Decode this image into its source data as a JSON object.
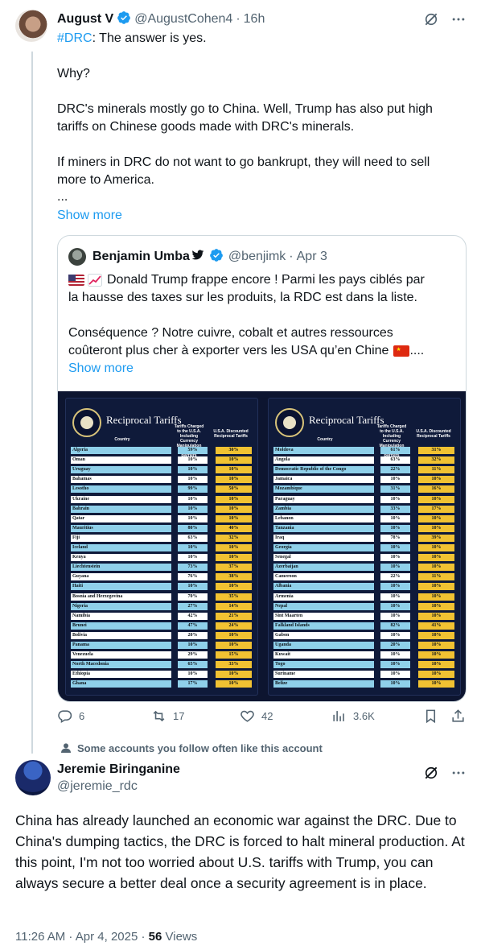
{
  "tweet": {
    "author_name": "August V",
    "author_handle": "@AugustCohen4",
    "time": "16h",
    "hashtag": "#DRC",
    "line1": ": The answer is yes.",
    "p2": "Why?",
    "p3a": "DRC's minerals mostly go to China.  Well, Trump has also put high",
    "p3b": "tariffs on Chinese goods made with DRC's minerals.",
    "p4a": "If miners in DRC do not want to go bankrupt, they will need to sell",
    "p4b": "more to America.",
    "ellipsis": "...",
    "show_more": "Show more",
    "stats": {
      "replies": "6",
      "reposts": "17",
      "likes": "42",
      "views": "3.6K"
    }
  },
  "quote": {
    "author_name": "Benjamin Umba",
    "author_handle": "@benjimk",
    "time": "Apr 3",
    "line1": "Donald Trump frappe encore ! Parmi les pays ciblés par",
    "line2": "la hausse des taxes sur les produits, la RDC est dans la liste.",
    "line3": "Conséquence ? Notre cuivre, cobalt et autres ressources",
    "line4": "coûteront plus cher à exporter vers les USA qu’en Chine",
    "line4_end": "....",
    "show_more": "Show more"
  },
  "tariff_image": {
    "title": "Reciprocal Tariffs",
    "col_country": "Country",
    "col_charged": "Tariffs Charged to the U.S.A. Including Currency Manipulation and Trade Barriers",
    "col_discounted": "U.S.A. Discounted Reciprocal Tariffs",
    "left": [
      [
        "Algeria",
        "59%",
        "30%"
      ],
      [
        "Oman",
        "10%",
        "10%"
      ],
      [
        "Uruguay",
        "10%",
        "10%"
      ],
      [
        "Bahamas",
        "10%",
        "10%"
      ],
      [
        "Lesotho",
        "99%",
        "50%"
      ],
      [
        "Ukraine",
        "10%",
        "10%"
      ],
      [
        "Bahrain",
        "10%",
        "10%"
      ],
      [
        "Qatar",
        "10%",
        "10%"
      ],
      [
        "Mauritius",
        "80%",
        "40%"
      ],
      [
        "Fiji",
        "63%",
        "32%"
      ],
      [
        "Iceland",
        "10%",
        "10%"
      ],
      [
        "Kenya",
        "10%",
        "10%"
      ],
      [
        "Liechtenstein",
        "73%",
        "37%"
      ],
      [
        "Guyana",
        "76%",
        "38%"
      ],
      [
        "Haiti",
        "10%",
        "10%"
      ],
      [
        "Bosnia and Herzegovina",
        "70%",
        "35%"
      ],
      [
        "Nigeria",
        "27%",
        "14%"
      ],
      [
        "Namibia",
        "42%",
        "21%"
      ],
      [
        "Brunei",
        "47%",
        "24%"
      ],
      [
        "Bolivia",
        "20%",
        "10%"
      ],
      [
        "Panama",
        "10%",
        "10%"
      ],
      [
        "Venezuela",
        "29%",
        "15%"
      ],
      [
        "North Macedonia",
        "65%",
        "33%"
      ],
      [
        "Ethiopia",
        "10%",
        "10%"
      ],
      [
        "Ghana",
        "17%",
        "10%"
      ]
    ],
    "right": [
      [
        "Moldova",
        "61%",
        "31%"
      ],
      [
        "Angola",
        "63%",
        "32%"
      ],
      [
        "Democratic Republic of the Congo",
        "22%",
        "11%"
      ],
      [
        "Jamaica",
        "10%",
        "10%"
      ],
      [
        "Mozambique",
        "31%",
        "16%"
      ],
      [
        "Paraguay",
        "10%",
        "10%"
      ],
      [
        "Zambia",
        "33%",
        "17%"
      ],
      [
        "Lebanon",
        "10%",
        "10%"
      ],
      [
        "Tanzania",
        "10%",
        "10%"
      ],
      [
        "Iraq",
        "78%",
        "39%"
      ],
      [
        "Georgia",
        "10%",
        "10%"
      ],
      [
        "Senegal",
        "10%",
        "10%"
      ],
      [
        "Azerbaijan",
        "10%",
        "10%"
      ],
      [
        "Cameroon",
        "22%",
        "11%"
      ],
      [
        "Albania",
        "10%",
        "10%"
      ],
      [
        "Armenia",
        "10%",
        "10%"
      ],
      [
        "Nepal",
        "10%",
        "10%"
      ],
      [
        "Sint Maarten",
        "10%",
        "10%"
      ],
      [
        "Falkland Islands",
        "82%",
        "41%"
      ],
      [
        "Gabon",
        "10%",
        "10%"
      ],
      [
        "Uganda",
        "20%",
        "10%"
      ],
      [
        "Kuwait",
        "10%",
        "10%"
      ],
      [
        "Togo",
        "10%",
        "10%"
      ],
      [
        "Suriname",
        "10%",
        "10%"
      ],
      [
        "Belize",
        "10%",
        "10%"
      ]
    ]
  },
  "social_context": "Some accounts you follow often like this account",
  "reply": {
    "author_name": "Jeremie Biringanine",
    "author_handle": "@jeremie_rdc",
    "text": "China has already launched an economic war against the DRC. Due to China's dumping tactics, the DRC is forced to halt mineral production. At this point, I'm not too worried about U.S. tariffs with Trump, you can always secure a better deal once a security agreement is in place.",
    "timestamp": "11:26 AM · Apr 4, 2025 · ",
    "views_count": "56",
    "views_label": " Views"
  },
  "colors": {
    "accent": "#1d9bf0",
    "muted": "#536471",
    "border": "#cfd9de"
  }
}
